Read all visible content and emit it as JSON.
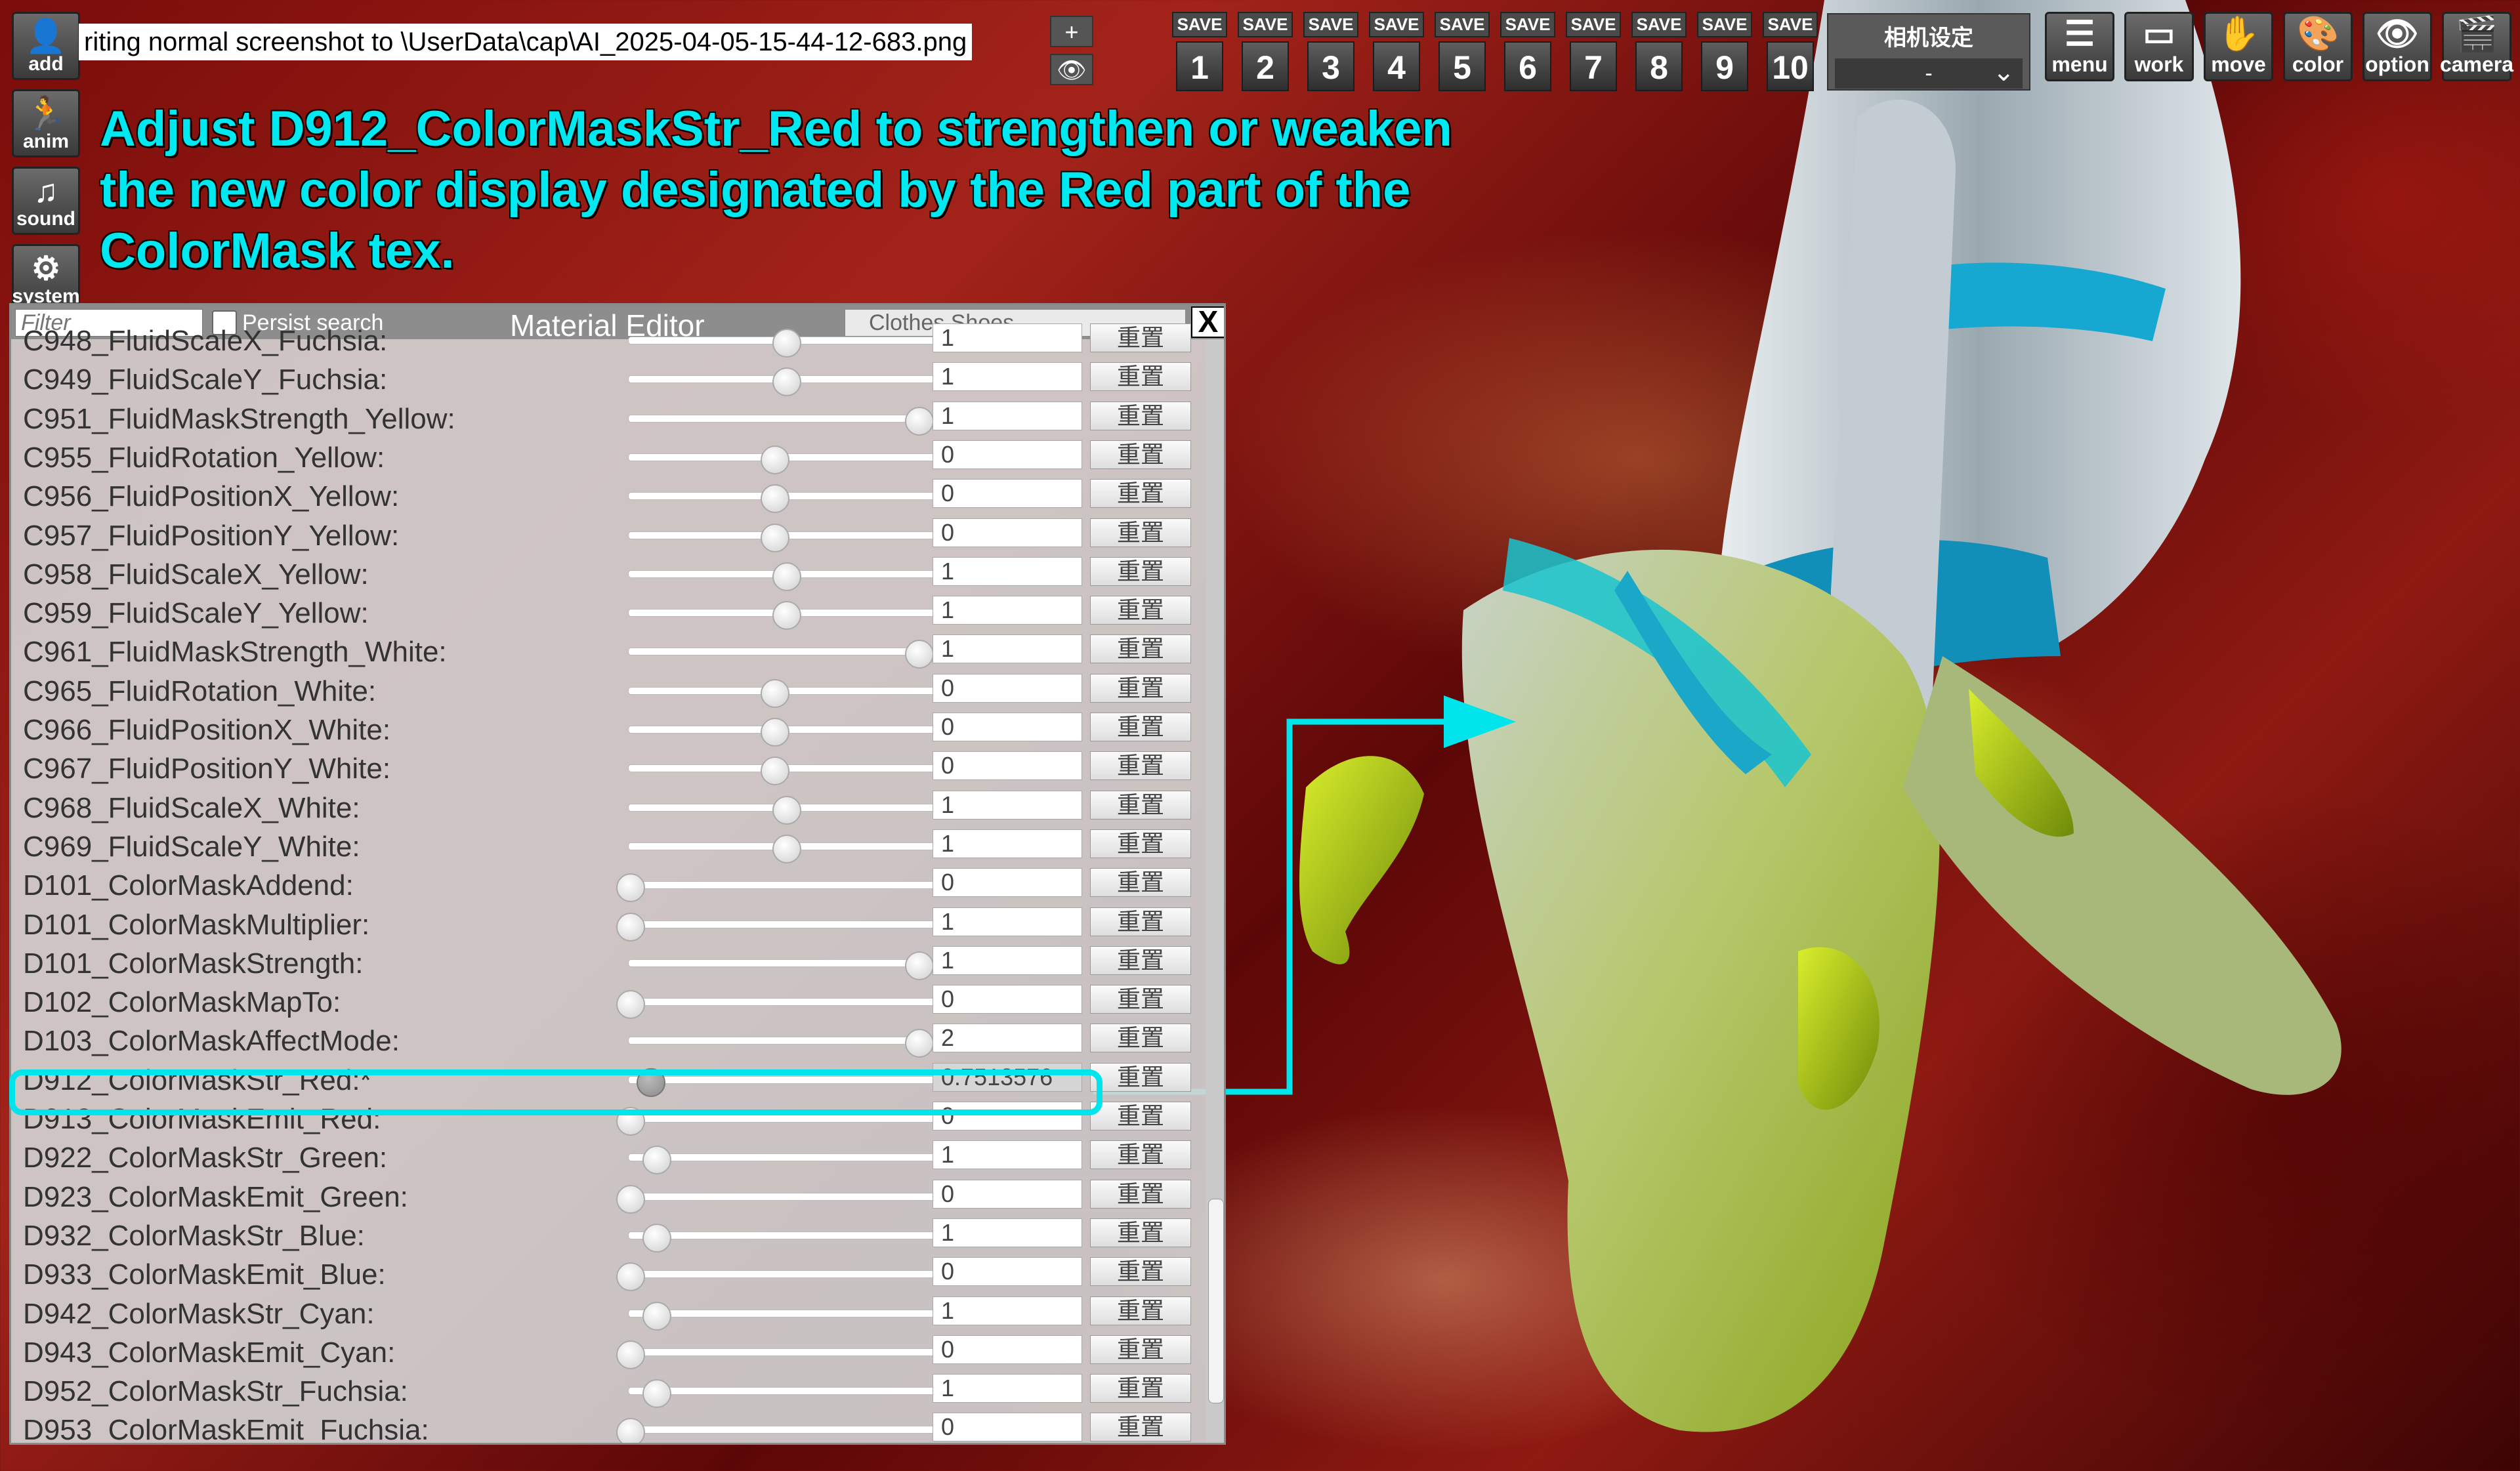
{
  "left_toolbar": [
    {
      "icon": "add-figure-icon",
      "label": "add",
      "glyph": "👤"
    },
    {
      "icon": "anim-icon",
      "label": "anim",
      "glyph": "🏃"
    },
    {
      "icon": "sound-icon",
      "label": "sound",
      "glyph": "♫"
    },
    {
      "icon": "system-icon",
      "label": "system",
      "glyph": "⚙"
    }
  ],
  "file_path": "riting normal screenshot to \\UserData\\cap\\AI_2025-04-05-15-44-12-683.png",
  "small_buttons": {
    "plus": "+",
    "eye": "👁"
  },
  "save_slots": [
    {
      "tag": "SAVE",
      "number": "1"
    },
    {
      "tag": "SAVE",
      "number": "2"
    },
    {
      "tag": "SAVE",
      "number": "3"
    },
    {
      "tag": "SAVE",
      "number": "4"
    },
    {
      "tag": "SAVE",
      "number": "5"
    },
    {
      "tag": "SAVE",
      "number": "6"
    },
    {
      "tag": "SAVE",
      "number": "7"
    },
    {
      "tag": "SAVE",
      "number": "8"
    },
    {
      "tag": "SAVE",
      "number": "9"
    },
    {
      "tag": "SAVE",
      "number": "10"
    }
  ],
  "camera_settings": {
    "title": "相机设定",
    "value": "-"
  },
  "right_toolbar": [
    {
      "icon": "menu-icon",
      "label": "menu",
      "glyph": "☰"
    },
    {
      "icon": "work-icon",
      "label": "work",
      "glyph": "▭"
    },
    {
      "icon": "move-icon",
      "label": "move",
      "glyph": "✋"
    },
    {
      "icon": "color-palette-icon",
      "label": "color",
      "glyph": "🎨"
    },
    {
      "icon": "eye-icon",
      "label": "option",
      "glyph": "👁"
    },
    {
      "icon": "camera-clapper-icon",
      "label": "camera",
      "glyph": "🎬"
    }
  ],
  "annotation": {
    "line1": "Adjust D912_ColorMaskStr_Red to strengthen or weaken",
    "line2": "the new color display designated by the Red part of the",
    "line3": "ColorMask tex."
  },
  "editor": {
    "filter_placeholder": "Filter",
    "persist_label": "Persist search",
    "title": "Material Editor",
    "category": "Clothes Shoes",
    "close": "X",
    "reset_label": "重置",
    "rows": [
      {
        "label": "C948_FluidScaleX_Fuchsia:",
        "value": "1",
        "slider": 0.54
      },
      {
        "label": "C949_FluidScaleY_Fuchsia:",
        "value": "1",
        "slider": 0.54
      },
      {
        "label": "C951_FluidMaskStrength_Yellow:",
        "value": "1",
        "slider": 1.0
      },
      {
        "label": "C955_FluidRotation_Yellow:",
        "value": "0",
        "slider": 0.5
      },
      {
        "label": "C956_FluidPositionX_Yellow:",
        "value": "0",
        "slider": 0.5
      },
      {
        "label": "C957_FluidPositionY_Yellow:",
        "value": "0",
        "slider": 0.5
      },
      {
        "label": "C958_FluidScaleX_Yellow:",
        "value": "1",
        "slider": 0.54
      },
      {
        "label": "C959_FluidScaleY_Yellow:",
        "value": "1",
        "slider": 0.54
      },
      {
        "label": "C961_FluidMaskStrength_White:",
        "value": "1",
        "slider": 1.0
      },
      {
        "label": "C965_FluidRotation_White:",
        "value": "0",
        "slider": 0.5
      },
      {
        "label": "C966_FluidPositionX_White:",
        "value": "0",
        "slider": 0.5
      },
      {
        "label": "C967_FluidPositionY_White:",
        "value": "0",
        "slider": 0.5
      },
      {
        "label": "C968_FluidScaleX_White:",
        "value": "1",
        "slider": 0.54
      },
      {
        "label": "C969_FluidScaleY_White:",
        "value": "1",
        "slider": 0.54
      },
      {
        "label": "D101_ColorMaskAddend:",
        "value": "0",
        "slider": 0.0
      },
      {
        "label": "D101_ColorMaskMultiplier:",
        "value": "1",
        "slider": 0.0
      },
      {
        "label": "D101_ColorMaskStrength:",
        "value": "1",
        "slider": 1.0
      },
      {
        "label": "D102_ColorMaskMapTo:",
        "value": "0",
        "slider": 0.0
      },
      {
        "label": "D103_ColorMaskAffectMode:",
        "value": "2",
        "slider": 1.0
      },
      {
        "label": "D912_ColorMaskStr_Red:*",
        "value": "0.7513576",
        "slider": 0.07,
        "highlight": true
      },
      {
        "label": "D913_ColorMaskEmit_Red:",
        "value": "0",
        "slider": 0.0
      },
      {
        "label": "D922_ColorMaskStr_Green:",
        "value": "1",
        "slider": 0.09
      },
      {
        "label": "D923_ColorMaskEmit_Green:",
        "value": "0",
        "slider": 0.0
      },
      {
        "label": "D932_ColorMaskStr_Blue:",
        "value": "1",
        "slider": 0.09
      },
      {
        "label": "D933_ColorMaskEmit_Blue:",
        "value": "0",
        "slider": 0.0
      },
      {
        "label": "D942_ColorMaskStr_Cyan:",
        "value": "1",
        "slider": 0.09
      },
      {
        "label": "D943_ColorMaskEmit_Cyan:",
        "value": "0",
        "slider": 0.0
      },
      {
        "label": "D952_ColorMaskStr_Fuchsia:",
        "value": "1",
        "slider": 0.09
      },
      {
        "label": "D953_ColorMaskEmit_Fuchsia:",
        "value": "0",
        "slider": 0.0
      }
    ]
  },
  "colors": {
    "annotation": "#00e8f0",
    "highlight": "#00e5ec"
  }
}
